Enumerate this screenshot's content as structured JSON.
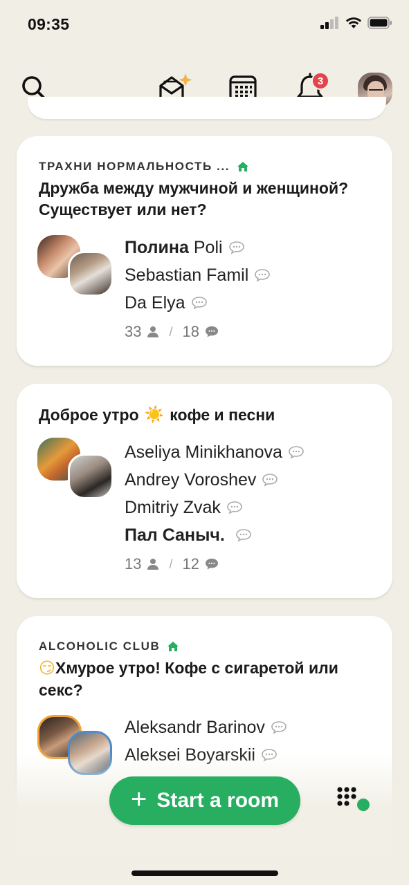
{
  "status_bar": {
    "time": "09:35"
  },
  "nav": {
    "notification_count": "3"
  },
  "rooms": [
    {
      "club": "ТРАХНИ НОРМАЛЬНОСТЬ ...",
      "title": "Дружба между мужчиной и женщиной? Существует или нет?",
      "speakers": [
        {
          "bold": "Полина",
          "name": "Poli"
        },
        {
          "bold": "",
          "name": "Sebastian Famil"
        },
        {
          "bold": "",
          "name": "Da Elya"
        }
      ],
      "listeners": "33",
      "chats": "18"
    },
    {
      "club": "",
      "title_prefix": "Доброе утро",
      "title_emoji": "☀️",
      "title_suffix": "кофе и песни",
      "speakers": [
        {
          "bold": "",
          "name": "Aseliya Minikhanova"
        },
        {
          "bold": "",
          "name": "Andrey Voroshev"
        },
        {
          "bold": "",
          "name": "Dmitriy Zvak"
        },
        {
          "bold": "Пал Саныч.",
          "name": ""
        }
      ],
      "listeners": "13",
      "chats": "12"
    },
    {
      "club": "ALCOHOLIC CLUB",
      "title_emoji": "😏",
      "title": "Хмурое утро! Кофе с сигаретой или секс?",
      "speakers": [
        {
          "bold": "",
          "name": "Aleksandr Barinov"
        },
        {
          "bold": "",
          "name": "Aleksei Boyarskii"
        }
      ]
    }
  ],
  "start_room": {
    "label": "Start a room"
  },
  "colors": {
    "accent": "#27ae60",
    "background": "#f1efe5",
    "badge": "#e3444c"
  },
  "icons": [
    "search-icon",
    "invite-envelope-icon",
    "calendar-icon",
    "bell-icon",
    "avatar",
    "person-icon",
    "chat-icon",
    "home-icon",
    "dots-grid-icon"
  ]
}
